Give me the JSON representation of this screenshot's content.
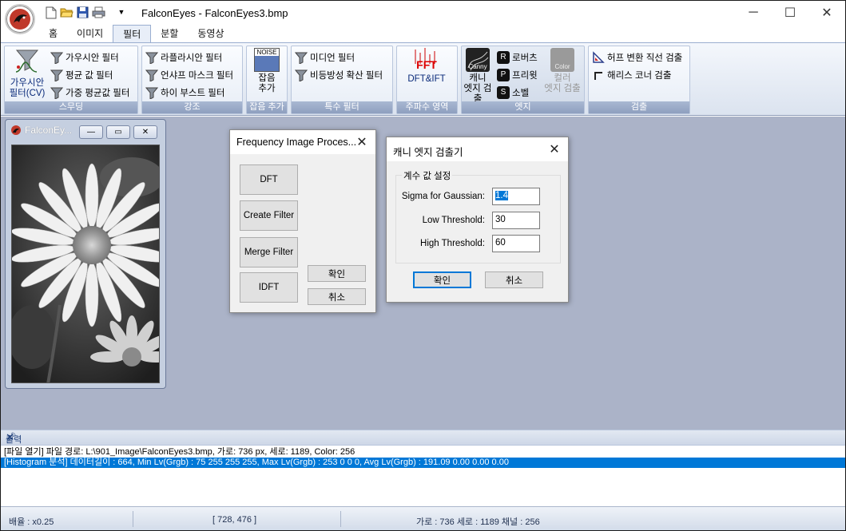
{
  "app": {
    "title": "FalconEyes - FalconEyes3.bmp",
    "quick_access": [
      "new-file-icon",
      "open-folder-icon",
      "save-icon",
      "print-icon"
    ],
    "window_controls": {
      "minimize": "─",
      "maximize": "☐",
      "close": "✕"
    }
  },
  "ribbon": {
    "tabs": [
      "홈",
      "이미지",
      "필터",
      "분할",
      "동영상"
    ],
    "active_tab": "필터",
    "groups": {
      "smoothing": {
        "label": "스무딩",
        "large": "가우시안\n필터(CV)",
        "items": [
          "가우시안 필터",
          "평균 값 필터",
          "가중 평균값 필터"
        ]
      },
      "enhance": {
        "label": "강조",
        "items": [
          "라플라시안 필터",
          "언샤프 마스크 필터",
          "하이 부스트 필터"
        ]
      },
      "noise": {
        "label": "잡음 추가",
        "icon_text": "NOISE",
        "large": "잡음\n추가"
      },
      "special": {
        "label": "특수 필터",
        "items": [
          "미디언 필터",
          "비등방성 확산 필터"
        ]
      },
      "frequency": {
        "label": "주파수 영역",
        "icon_text": "FFT",
        "large": "DFT&IFT"
      },
      "edge": {
        "label": "엣지",
        "canny": "캐니\n엣지 검출",
        "canny_icon_text": "Canny",
        "items": [
          "로버츠",
          "프리윗",
          "소벨"
        ],
        "item_badges": [
          "R",
          "P",
          "S"
        ],
        "color": "컬러\n엣지 검출",
        "color_icon_text": "Color"
      },
      "detect": {
        "label": "검출",
        "items": [
          "허프 변환 직선 검출",
          "해리스 코너 검출"
        ]
      }
    }
  },
  "child_window": {
    "title": "FalconEy...",
    "buttons": {
      "min": "—",
      "restore": "▭",
      "close": "✕"
    }
  },
  "freq_dialog": {
    "title": "Frequency Image Proces...",
    "buttons": [
      "DFT",
      "Create Filter",
      "Merge Filter",
      "IDFT"
    ],
    "ok": "확인",
    "cancel": "취소"
  },
  "canny_dialog": {
    "title": "캐니 엣지 검출기",
    "group_label": "계수 값 설정",
    "fields": [
      {
        "label": "Sigma for Gaussian:",
        "value": "1.4"
      },
      {
        "label": "Low Threshold:",
        "value": "30"
      },
      {
        "label": "High Threshold:",
        "value": "60"
      }
    ],
    "ok": "확인",
    "cancel": "취소"
  },
  "output": {
    "title": "출력",
    "lines": [
      "[파일 열기] 파일 경로: L:\\901_Image\\FalconEyes3.bmp, 가로: 736 px, 세로: 1189, Color: 256",
      "[Histogram 분석] 데이터길이 : 664, Min Lv(Grgb) : 75 255 255 255, Max Lv(Grgb) : 253 0 0 0, Avg Lv(Grgb) : 191.09 0.00 0.00 0.00"
    ],
    "selected_line": 1
  },
  "status": {
    "zoom": "배율 : x0.25",
    "coords": "[ 728, 476 ]",
    "size": "가로 : 736  세로 : 1189  채널 : 256"
  },
  "colors": {
    "accent": "#0078d7",
    "workspace": "#abb3c8",
    "group_label": "#8e9fbf"
  }
}
